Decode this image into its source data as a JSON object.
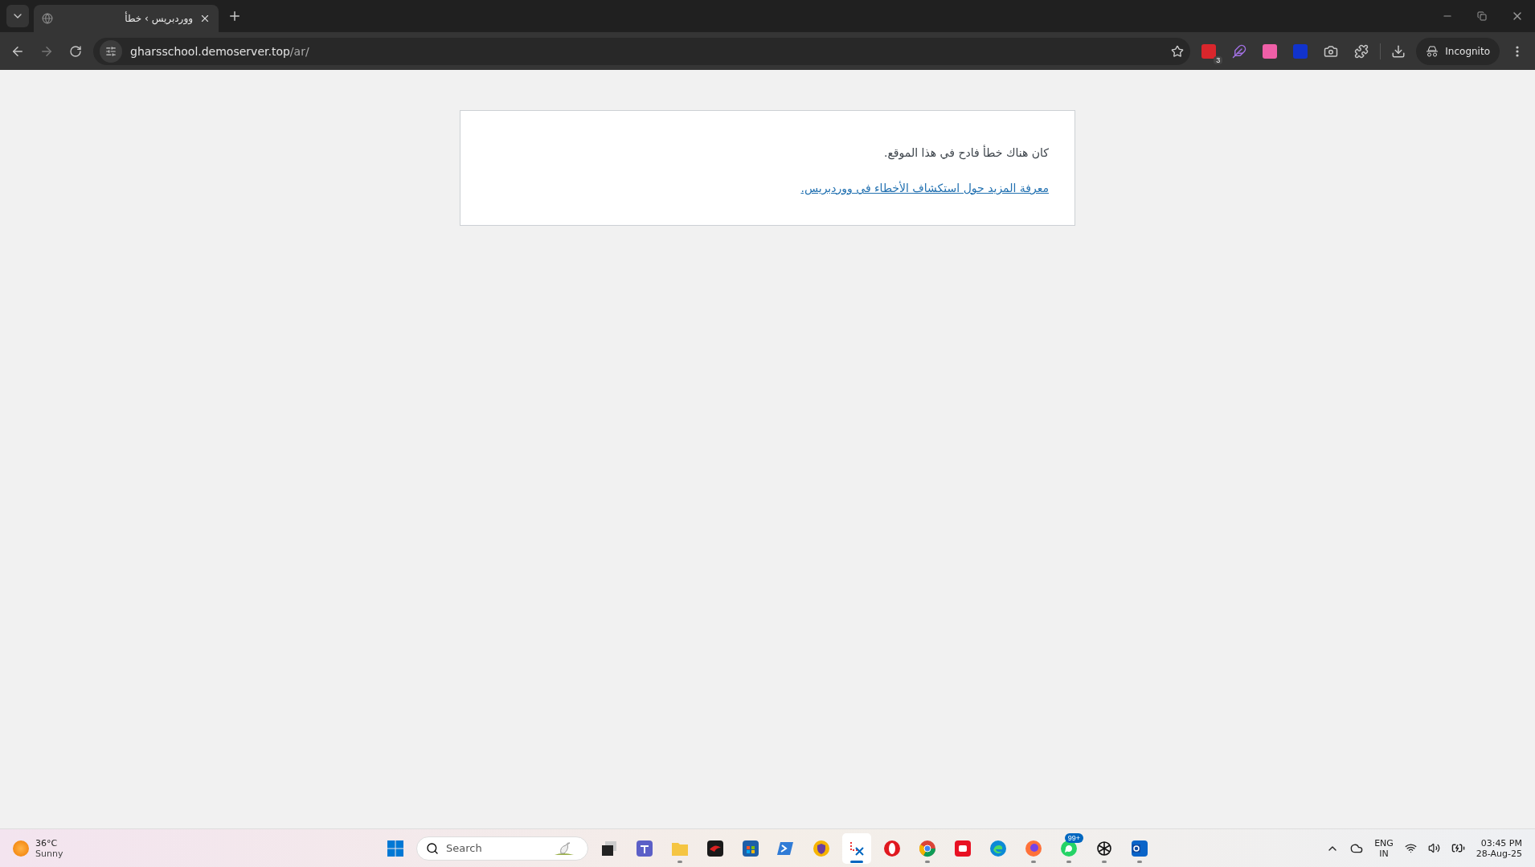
{
  "browser": {
    "tab": {
      "title": "ووردبريس › خطأ",
      "selected": true
    },
    "address": {
      "host": "gharsschool.demoserver.top",
      "path": "/ar/"
    },
    "extensions": [
      {
        "kind": "red",
        "badge": "3"
      },
      {
        "kind": "feather"
      },
      {
        "kind": "pink"
      },
      {
        "kind": "blue"
      },
      {
        "kind": "camera"
      },
      {
        "kind": "puzzle"
      }
    ],
    "profile": "Incognito"
  },
  "page": {
    "message": "كان هناك خطأ فادح في هذا الموقع.",
    "link": "معرفة المزيد حول استكشاف الأخطاء في ووردبريس."
  },
  "taskbar": {
    "weather": {
      "temperature": "36°C",
      "condition": "Sunny"
    },
    "search": {
      "placeholder": "Search"
    },
    "apps": [
      {
        "kind": "taskview",
        "running": false,
        "active": false
      },
      {
        "kind": "teams",
        "running": false,
        "active": false
      },
      {
        "kind": "files",
        "running": true,
        "active": false
      },
      {
        "kind": "dragon",
        "running": false,
        "active": false
      },
      {
        "kind": "store",
        "running": false,
        "active": false
      },
      {
        "kind": "terminal",
        "running": false,
        "active": false
      },
      {
        "kind": "shield",
        "running": false,
        "active": false
      },
      {
        "kind": "snip",
        "running": true,
        "active": true
      },
      {
        "kind": "opera",
        "running": false,
        "active": false
      },
      {
        "kind": "chrome",
        "running": true,
        "active": false
      },
      {
        "kind": "recorder",
        "running": false,
        "active": false
      },
      {
        "kind": "edge",
        "running": false,
        "active": false
      },
      {
        "kind": "firefox",
        "running": true,
        "active": false
      },
      {
        "kind": "whatsapp",
        "running": true,
        "active": false,
        "badge": "99+"
      },
      {
        "kind": "chatgpt",
        "running": true,
        "active": false
      },
      {
        "kind": "outlook",
        "running": true,
        "active": false
      }
    ],
    "language": {
      "line1": "ENG",
      "line2": "IN"
    },
    "clock": {
      "time": "03:45 PM",
      "date": "28-Aug-25"
    }
  }
}
